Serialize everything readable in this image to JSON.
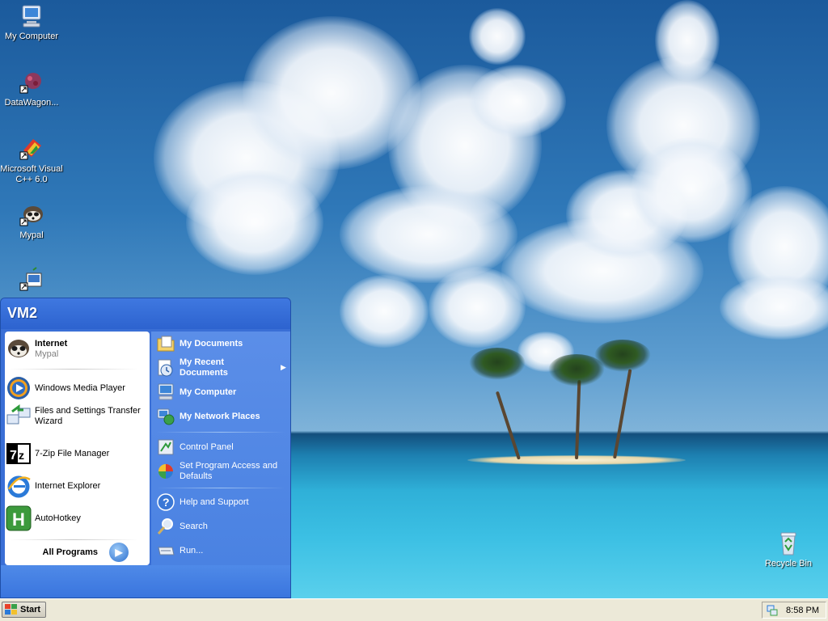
{
  "desktop": {
    "icons": [
      {
        "label": "My Computer",
        "icon": "my-computer-icon"
      },
      {
        "label": "DataWagon...",
        "icon": "datawagon-icon"
      },
      {
        "label": "Microsoft Visual C++ 6.0",
        "icon": "visual-cpp-icon"
      },
      {
        "label": "Mypal",
        "icon": "mypal-icon"
      },
      {
        "label": "",
        "icon": "remote-desktop-icon"
      }
    ],
    "recycle_bin": {
      "label": "Recycle Bin",
      "icon": "recycle-bin-icon"
    }
  },
  "start_menu": {
    "user": "VM2",
    "pinned": {
      "title": "Internet",
      "subtitle": "Mypal"
    },
    "programs": [
      {
        "label": "Windows Media Player",
        "icon": "media-player-icon"
      },
      {
        "label": "Files and Settings Transfer Wizard",
        "icon": "transfer-wizard-icon"
      },
      {
        "label": "7-Zip File Manager",
        "icon": "seven-zip-icon"
      },
      {
        "label": "Internet Explorer",
        "icon": "internet-explorer-icon"
      },
      {
        "label": "AutoHotkey",
        "icon": "autohotkey-icon"
      }
    ],
    "all_programs": "All Programs",
    "places": [
      {
        "label": "My Documents",
        "icon": "my-documents-icon"
      },
      {
        "label": "My Recent Documents",
        "icon": "recent-documents-icon"
      },
      {
        "label": "My Computer",
        "icon": "my-computer-icon"
      },
      {
        "label": "My Network Places",
        "icon": "network-places-icon"
      },
      {
        "label": "Control Panel",
        "icon": "control-panel-icon"
      },
      {
        "label": "Set Program Access and Defaults",
        "icon": "program-access-icon"
      },
      {
        "label": "Help and Support",
        "icon": "help-icon"
      },
      {
        "label": "Search",
        "icon": "search-icon"
      },
      {
        "label": "Run...",
        "icon": "run-icon"
      }
    ]
  },
  "taskbar": {
    "start_label": "Start",
    "clock": "8:58 PM"
  },
  "colors": {
    "menu_blue": "#3a6fd6",
    "taskbar": "#ece9d8"
  }
}
